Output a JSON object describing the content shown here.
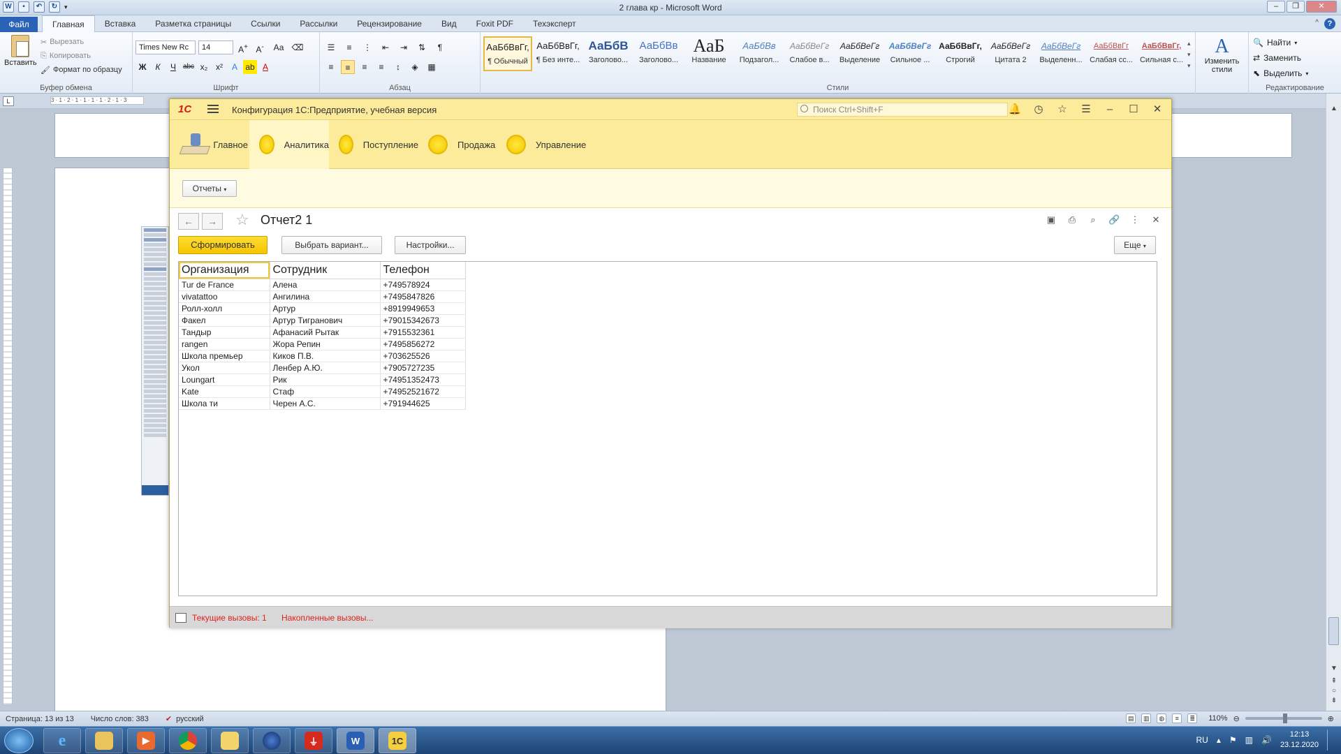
{
  "word": {
    "title": "2 глава кр  -  Microsoft Word",
    "tabs": [
      "Главная",
      "Вставка",
      "Разметка страницы",
      "Ссылки",
      "Рассылки",
      "Рецензирование",
      "Вид",
      "Foxit PDF",
      "Техэксперт"
    ],
    "file_tab": "Файл",
    "clipboard": {
      "paste": "Вставить",
      "cut": "Вырезать",
      "copy": "Копировать",
      "format_painter": "Формат по образцу",
      "caption": "Буфер обмена"
    },
    "font": {
      "name": "Times New Rc",
      "size": "14",
      "caption": "Шрифт",
      "case": "Аа"
    },
    "paragraph": {
      "caption": "Абзац"
    },
    "styles": {
      "items": [
        {
          "preview": "АаБбВвГг,",
          "name": "¶ Обычный"
        },
        {
          "preview": "АаБбВвГг,",
          "name": "¶ Без инте..."
        },
        {
          "preview": "АаБбВ",
          "name": "Заголово..."
        },
        {
          "preview": "АаБбВв",
          "name": "Заголово..."
        },
        {
          "preview": "АаБ",
          "name": "Название"
        },
        {
          "preview": "АаБбВв",
          "name": "Подзагол..."
        },
        {
          "preview": "АаБбВеГг",
          "name": "Слабое в..."
        },
        {
          "preview": "АаБбВеГг",
          "name": "Выделение"
        },
        {
          "preview": "АаБбВеГг",
          "name": "Сильное ..."
        },
        {
          "preview": "АаБбВвГг,",
          "name": "Строгий"
        },
        {
          "preview": "АаБбВеГг",
          "name": "Цитата 2"
        },
        {
          "preview": "АаБбВеГг",
          "name": "Выделенн..."
        },
        {
          "preview": "АаБбВвГг",
          "name": "Слабая сс..."
        },
        {
          "preview": "АаБбВвГг,",
          "name": "Сильная с..."
        }
      ],
      "change": "Изменить стили",
      "caption": "Стили"
    },
    "editing": {
      "find": "Найти",
      "replace": "Заменить",
      "select": "Выделить",
      "caption": "Редактирование"
    },
    "status": {
      "page": "Страница: 13 из 13",
      "words": "Число слов: 383",
      "lang": "русский",
      "zoom": "110%"
    }
  },
  "taskbar": {
    "lang": "RU",
    "time": "12:13",
    "date": "23.12.2020"
  },
  "onec": {
    "logo": "1С",
    "title": "Конфигурация 1С:Предприятие, учебная версия",
    "search_placeholder": "Поиск Ctrl+Shift+F",
    "sections": [
      "Главное",
      "Аналитика",
      "Поступление",
      "Продажа",
      "Управление"
    ],
    "active_section": "Аналитика",
    "reports_button": "Отчеты",
    "form_title": "Отчет2 1",
    "buttons": {
      "generate": "Сформировать",
      "choose_variant": "Выбрать вариант...",
      "settings": "Настройки...",
      "more": "Еще"
    },
    "report": {
      "columns": [
        "Организация",
        "Сотрудник",
        "Телефон"
      ],
      "rows": [
        [
          "Tur de France",
          "Алена",
          "+749578924"
        ],
        [
          "vivatattoo",
          "Ангилина",
          "+7495847826"
        ],
        [
          "Ролл-холл",
          "Артур",
          "+8919949653"
        ],
        [
          "Факел",
          "Артур Тигранович",
          "+79015342673"
        ],
        [
          "Тандыр",
          "Афанасий Рытак",
          "+7915532361"
        ],
        [
          "rangen",
          "Жора Репин",
          "+7495856272"
        ],
        [
          "Школа премьер",
          "Киков П.В.",
          "+703625526"
        ],
        [
          "Укол",
          "Ленбер А.Ю.",
          "+7905727235"
        ],
        [
          "Loungart",
          "Рик",
          "+74951352473"
        ],
        [
          "Kate",
          "Стаф",
          "+74952521672"
        ],
        [
          "Школа ти",
          "Черен А.С.",
          "+791944625"
        ]
      ]
    },
    "footer": {
      "current_calls": "Текущие вызовы: 1",
      "accumulated_calls": "Накопленные вызовы..."
    }
  }
}
